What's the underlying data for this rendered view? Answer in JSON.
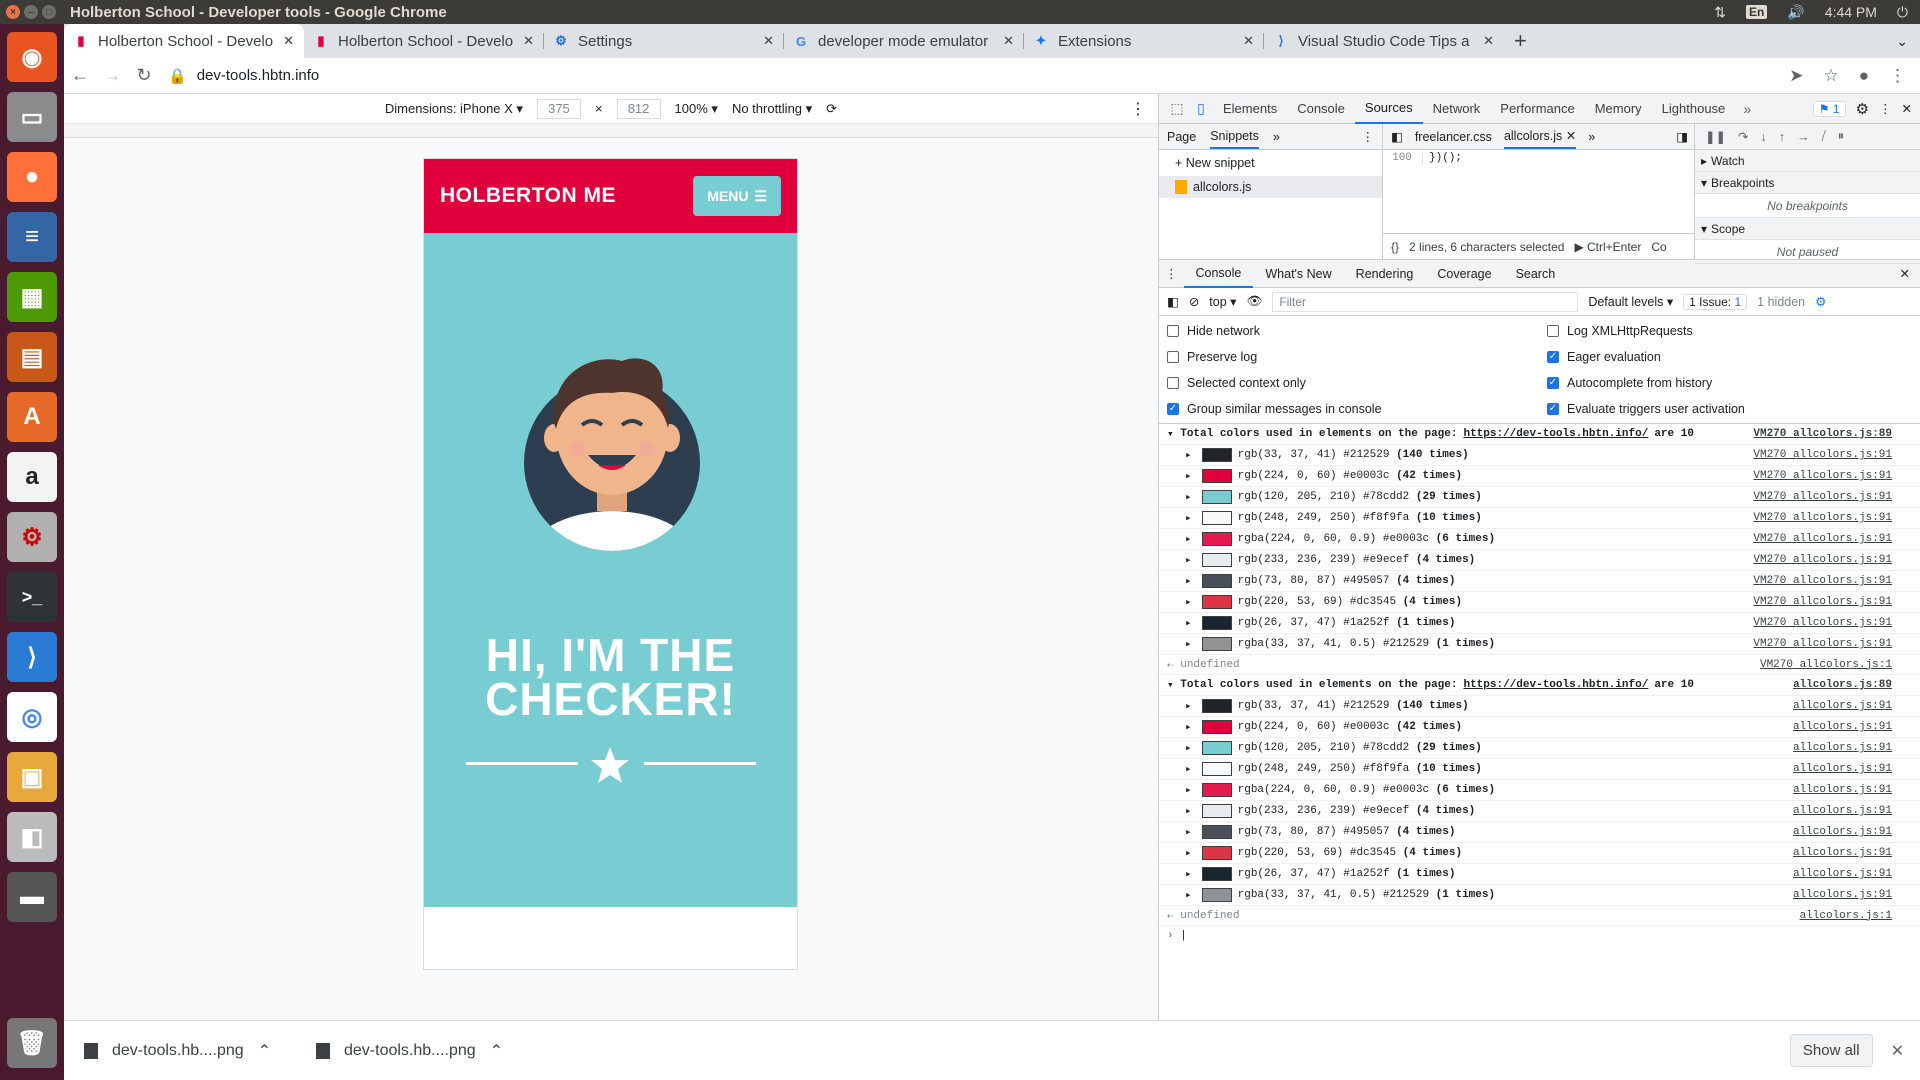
{
  "os": {
    "window_title": "Holberton School - Developer tools - Google Chrome",
    "lang": "En",
    "time": "4:44 PM"
  },
  "tabs": [
    {
      "label": "Holberton School - Develo",
      "icon": "holberton-icon",
      "active": true
    },
    {
      "label": "Holberton School - Develo",
      "icon": "holberton-icon",
      "active": false
    },
    {
      "label": "Settings",
      "icon": "gear-icon",
      "active": false
    },
    {
      "label": "developer mode emulator",
      "icon": "google-icon",
      "active": false
    },
    {
      "label": "Extensions",
      "icon": "puzzle-icon",
      "active": false
    },
    {
      "label": "Visual Studio Code Tips a",
      "icon": "vscode-icon",
      "active": false
    }
  ],
  "address": {
    "url": "dev-tools.hbtn.info"
  },
  "emulation": {
    "dimensions": "Dimensions: iPhone X",
    "width": "375",
    "times": "×",
    "height": "812",
    "zoom": "100%",
    "throttle": "No throttling"
  },
  "page": {
    "brand": "HOLBERTON ME",
    "menu": "MENU",
    "title_line1": "HI, I'M THE",
    "title_line2": "CHECKER!"
  },
  "devtools": {
    "tabs": [
      "Elements",
      "Console",
      "Sources",
      "Network",
      "Performance",
      "Memory",
      "Lighthouse"
    ],
    "active_tab": "Sources",
    "issues_badge": "1",
    "sources": {
      "nav_tabs": [
        "Page",
        "Snippets"
      ],
      "new_snippet": "New snippet",
      "snippet": "allcolors.js",
      "editor_tabs": [
        "freelancer.css",
        "allcolors.js"
      ],
      "line_number": "100",
      "line_code": "})();",
      "status": "2 lines, 6 characters selected",
      "run": "Ctrl+Enter",
      "run_cut": "Co",
      "watch": "Watch",
      "breakpoints": "Breakpoints",
      "no_breakpoints": "No breakpoints",
      "scope": "Scope",
      "not_paused": "Not paused"
    },
    "drawer_tabs": [
      "Console",
      "What's New",
      "Rendering",
      "Coverage",
      "Search"
    ],
    "console_toolbar": {
      "context": "top",
      "filter": "Filter",
      "levels": "Default levels",
      "issue": "1 Issue:",
      "issue_count": "1",
      "hidden": "1 hidden"
    },
    "options_left": [
      {
        "label": "Hide network",
        "checked": false
      },
      {
        "label": "Preserve log",
        "checked": false
      },
      {
        "label": "Selected context only",
        "checked": false
      },
      {
        "label": "Group similar messages in console",
        "checked": true
      }
    ],
    "options_right": [
      {
        "label": "Log XMLHttpRequests",
        "checked": false
      },
      {
        "label": "Eager evaluation",
        "checked": true
      },
      {
        "label": "Autocomplete from history",
        "checked": true
      },
      {
        "label": "Evaluate triggers user activation",
        "checked": true
      }
    ],
    "groups": [
      {
        "header_pre": "Total colors used in elements on the page:",
        "header_url": "https://dev-tools.hbtn.info/",
        "header_post": "are 10",
        "header_src": "VM270 allcolors.js:89",
        "row_src": "VM270 allcolors.js:91",
        "undef_src": "VM270 allcolors.js:1"
      },
      {
        "header_pre": "Total colors used in elements on the page:",
        "header_url": "https://dev-tools.hbtn.info/",
        "header_post": "are 10",
        "header_src": "allcolors.js:89",
        "row_src": "allcolors.js:91",
        "undef_src": "allcolors.js:1"
      }
    ],
    "colors": [
      {
        "text": "rgb(33, 37, 41) #212529",
        "count": "(140 times)",
        "swatch": "#212529"
      },
      {
        "text": "rgb(224, 0, 60) #e0003c",
        "count": "(42 times)",
        "swatch": "#e0003c"
      },
      {
        "text": "rgb(120, 205, 210) #78cdd2",
        "count": "(29 times)",
        "swatch": "#78cdd2"
      },
      {
        "text": "rgb(248, 249, 250) #f8f9fa",
        "count": "(10 times)",
        "swatch": "#f8f9fa"
      },
      {
        "text": "rgba(224, 0, 60, 0.9) #e0003c",
        "count": "(6 times)",
        "swatch": "#e31a50"
      },
      {
        "text": "rgb(233, 236, 239) #e9ecef",
        "count": "(4 times)",
        "swatch": "#e9ecef"
      },
      {
        "text": "rgb(73, 80, 87) #495057",
        "count": "(4 times)",
        "swatch": "#495057"
      },
      {
        "text": "rgb(220, 53, 69) #dc3545",
        "count": "(4 times)",
        "swatch": "#dc3545"
      },
      {
        "text": "rgb(26, 37, 47) #1a252f",
        "count": "(1 times)",
        "swatch": "#1a252f"
      },
      {
        "text": "rgba(33, 37, 41, 0.5) #212529",
        "count": "(1 times)",
        "swatch": "#909294"
      }
    ],
    "undefined_label": "undefined"
  },
  "downloads": [
    {
      "name": "dev-tools.hb....png"
    },
    {
      "name": "dev-tools.hb....png"
    }
  ],
  "show_all": "Show all",
  "colors_theme": {
    "brand_red": "#e0003c",
    "brand_teal": "#78cdd2",
    "launcher": "#4a1b2e"
  }
}
